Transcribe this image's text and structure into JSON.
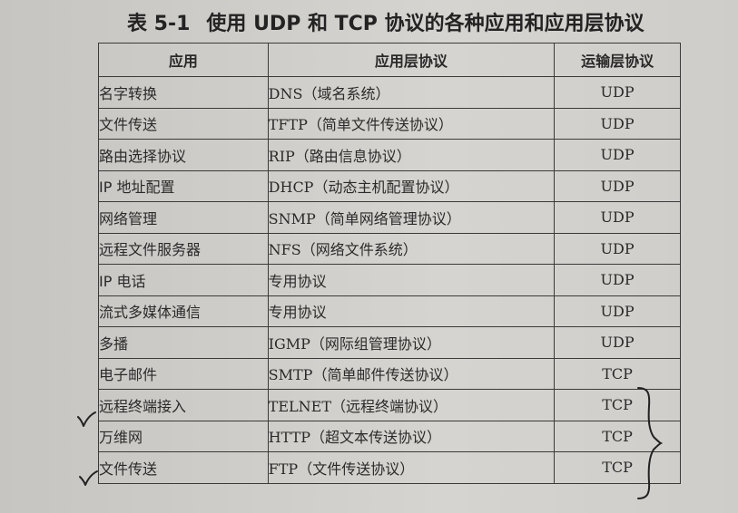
{
  "caption": {
    "number": "表 5-1",
    "title": "使用 UDP 和 TCP 协议的各种应用和应用层协议"
  },
  "table": {
    "headers": [
      "应用",
      "应用层协议",
      "运输层协议"
    ],
    "rows": [
      [
        "名字转换",
        "DNS（域名系统）",
        "UDP"
      ],
      [
        "文件传送",
        "TFTP（简单文件传送协议）",
        "UDP"
      ],
      [
        "路由选择协议",
        "RIP（路由信息协议）",
        "UDP"
      ],
      [
        "IP 地址配置",
        "DHCP（动态主机配置协议）",
        "UDP"
      ],
      [
        "网络管理",
        "SNMP（简单网络管理协议）",
        "UDP"
      ],
      [
        "远程文件服务器",
        "NFS（网络文件系统）",
        "UDP"
      ],
      [
        "IP 电话",
        "专用协议",
        "UDP"
      ],
      [
        "流式多媒体通信",
        "专用协议",
        "UDP"
      ],
      [
        "多播",
        "IGMP（网际组管理协议）",
        "UDP"
      ],
      [
        "电子邮件",
        "SMTP（简单邮件传送协议）",
        "TCP"
      ],
      [
        "远程终端接入",
        "TELNET（远程终端协议）",
        "TCP"
      ],
      [
        "万维网",
        "HTTP（超文本传送协议）",
        "TCP"
      ],
      [
        "文件传送",
        "FTP（文件传送协议）",
        "TCP"
      ]
    ]
  },
  "colors": {
    "ink": "#2a2a2a",
    "pen": "#222222",
    "paper": "#d2d0cc"
  },
  "annotations": {
    "check_rows": [
      10,
      12
    ],
    "brace_icon": "right-brace-icon",
    "check_icon": "checkmark-icon"
  }
}
